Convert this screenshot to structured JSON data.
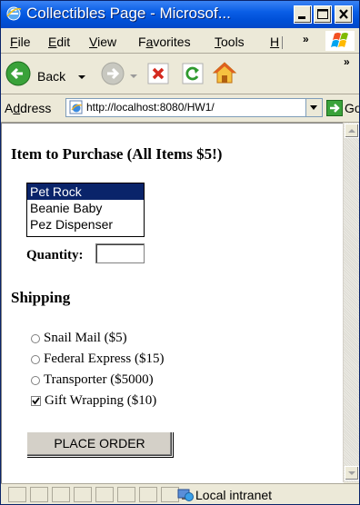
{
  "window": {
    "title": "Collectibles Page - Microsof..."
  },
  "menu": {
    "items": [
      {
        "underline": "F",
        "rest": "ile"
      },
      {
        "underline": "E",
        "rest": "dit"
      },
      {
        "underline": "V",
        "rest": "iew"
      },
      {
        "pre": "F",
        "underline": "a",
        "rest": "vorites"
      },
      {
        "underline": "T",
        "rest": "ools"
      },
      {
        "underline": "H",
        "rest": ""
      }
    ],
    "overflow": "»"
  },
  "toolbar": {
    "back_label": "Back",
    "overflow": "»"
  },
  "address": {
    "label_underline": "d",
    "label_pre": "A",
    "label_rest": "dress",
    "url": "http://localhost:8080/HW1/",
    "go_label": "Go"
  },
  "page": {
    "item_heading": "Item to Purchase (All Items $5!)",
    "items": [
      "Pet Rock",
      "Beanie Baby",
      "Pez Dispenser"
    ],
    "selected_item": "Pet Rock",
    "quantity_label": "Quantity:",
    "quantity_value": "",
    "shipping_heading": "Shipping",
    "shipping_options": [
      "Snail Mail ($5)",
      "Federal Express ($15)",
      "Transporter ($5000)"
    ],
    "gift_label": "Gift Wrapping ($10)",
    "gift_checked": true,
    "submit_label": "PLACE ORDER"
  },
  "status": {
    "zone": "Local intranet"
  }
}
